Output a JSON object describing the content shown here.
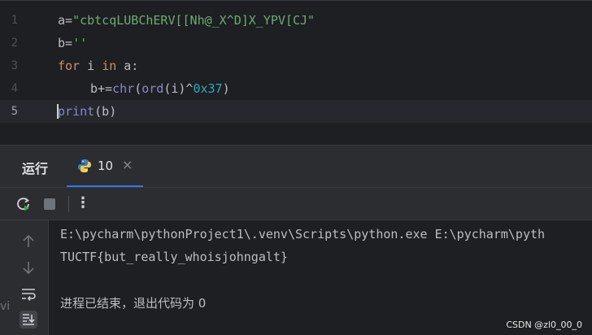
{
  "editor": {
    "lines": [
      {
        "number": "1",
        "a": "a=",
        "b": "\"cbtcqLUBChERV[[Nh@_X^D]X_YPV[CJ\""
      },
      {
        "number": "2",
        "a": "b=",
        "b": "''"
      },
      {
        "number": "3",
        "kw1": "for",
        "t1": " i ",
        "kw2": "in",
        "t2": " a:"
      },
      {
        "number": "4",
        "t1": "b+=",
        "f1": "chr",
        "t2": "(",
        "f2": "ord",
        "t3": "(i)^",
        "n": "0x37",
        "t4": ")"
      },
      {
        "number": "5",
        "f1": "print",
        "t1": "(b)"
      }
    ]
  },
  "run_panel": {
    "title": "运行",
    "tab_label": "10",
    "tab_close": "×",
    "more_label": "⋮"
  },
  "console": {
    "lines": [
      "E:\\pycharm\\pythonProject1\\.venv\\Scripts\\python.exe E:\\pycharm\\pyth",
      "TUCTF{but_really_whoisjohngalt}",
      "",
      "进程已结束，退出代码为 0"
    ]
  },
  "side_fragment": "vi",
  "watermark": "CSDN @zl0_00_0",
  "icons": {
    "tab": "python-icon",
    "rerun": "rerun-icon",
    "stop": "stop-icon",
    "up": "arrow-up-icon",
    "down": "arrow-down-icon",
    "wrap": "soft-wrap-icon",
    "scroll": "scroll-to-end-icon"
  }
}
